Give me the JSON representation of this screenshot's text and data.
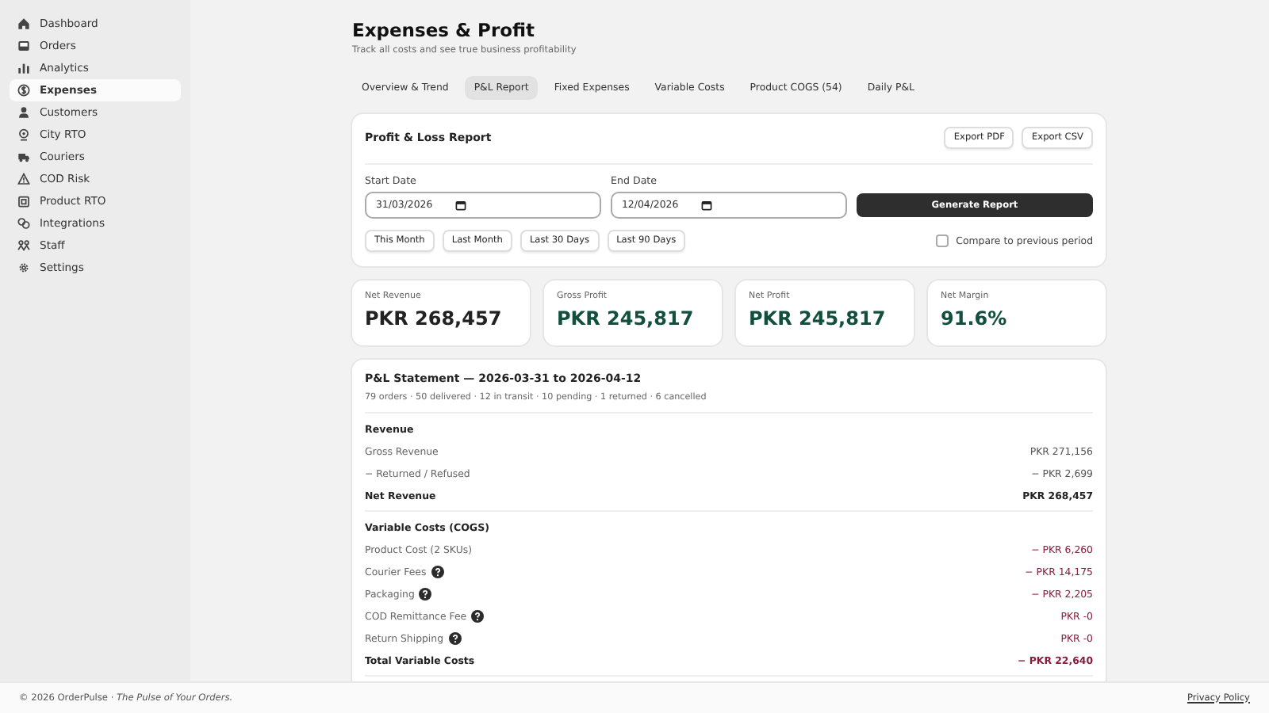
{
  "sidebar": {
    "items": [
      {
        "label": "Dashboard",
        "selected": false
      },
      {
        "label": "Orders",
        "selected": false
      },
      {
        "label": "Analytics",
        "selected": false
      },
      {
        "label": "Expenses",
        "selected": true
      },
      {
        "label": "Customers",
        "selected": false
      },
      {
        "label": "City RTO",
        "selected": false
      },
      {
        "label": "Couriers",
        "selected": false
      },
      {
        "label": "COD Risk",
        "selected": false
      },
      {
        "label": "Product RTO",
        "selected": false
      },
      {
        "label": "Integrations",
        "selected": false
      },
      {
        "label": "Staff",
        "selected": false
      },
      {
        "label": "Settings",
        "selected": false
      }
    ]
  },
  "header": {
    "title": "Expenses & Profit",
    "subtitle": "Track all costs and see true business profitability"
  },
  "tabs": [
    {
      "label": "Overview & Trend",
      "selected": false
    },
    {
      "label": "P&L Report",
      "selected": true
    },
    {
      "label": "Fixed Expenses",
      "selected": false
    },
    {
      "label": "Variable Costs",
      "selected": false
    },
    {
      "label": "Product COGS (54)",
      "selected": false
    },
    {
      "label": "Daily P&L",
      "selected": false
    }
  ],
  "report": {
    "title": "Profit & Loss Report",
    "export_buttons": [
      "Export PDF",
      "Export CSV"
    ],
    "start_date": {
      "label": "Start Date",
      "value": "31/03/2026"
    },
    "end_date": {
      "label": "End Date",
      "value": "12/04/2026"
    },
    "generate_button": "Generate Report",
    "presets": [
      "This Month",
      "Last Month",
      "Last 30 Days",
      "Last 90 Days"
    ],
    "compare": {
      "label": "Compare to previous period",
      "checked": false
    }
  },
  "stats": [
    {
      "label": "Net Revenue",
      "value": "PKR 268,457",
      "color": "#222222"
    },
    {
      "label": "Gross Profit",
      "value": "PKR 245,817",
      "color": "#134f3e"
    },
    {
      "label": "Net Profit",
      "value": "PKR 245,817",
      "color": "#134f3e"
    },
    {
      "label": "Net Margin",
      "value": "91.6%",
      "color": "#134f3e"
    }
  ],
  "statement": {
    "title": "P&L Statement — 2026-03-31 to 2026-04-12",
    "summary": "79 orders · 50 delivered · 12 in transit · 10 pending · 1 returned · 6 cancelled",
    "sections": [
      {
        "title": "Revenue",
        "rows": [
          {
            "label": "Gross Revenue",
            "amount": "PKR 271,156",
            "kind": "line",
            "color": "#555555",
            "info": false
          },
          {
            "label": "− Returned / Refused",
            "amount": "− PKR 2,699",
            "kind": "line",
            "color": "#555555",
            "info": false
          },
          {
            "label": "Net Revenue",
            "amount": "PKR 268,457",
            "kind": "total",
            "color": "#222222",
            "info": false
          }
        ]
      },
      {
        "title": "Variable Costs (COGS)",
        "rows": [
          {
            "label": "Product Cost (2 SKUs)",
            "amount": "− PKR 6,260",
            "kind": "line",
            "color": "#8b1d3c",
            "info": false
          },
          {
            "label": "Courier Fees",
            "amount": "− PKR 14,175",
            "kind": "line",
            "color": "#8b1d3c",
            "info": true
          },
          {
            "label": "Packaging",
            "amount": "− PKR 2,205",
            "kind": "line",
            "color": "#8b1d3c",
            "info": true
          },
          {
            "label": "COD Remittance Fee",
            "amount": "PKR -0",
            "kind": "line",
            "color": "#8b1d3c",
            "info": true
          },
          {
            "label": "Return Shipping",
            "amount": "PKR -0",
            "kind": "line",
            "color": "#8b1d3c",
            "info": true
          },
          {
            "label": "Total Variable Costs",
            "amount": "− PKR 22,640",
            "kind": "total",
            "color": "#8b1d3c",
            "info": false
          }
        ]
      }
    ]
  },
  "footer": {
    "text": "© 2026 OrderPulse · *The Pulse of Your Orders.*",
    "link": "Privacy Policy"
  }
}
